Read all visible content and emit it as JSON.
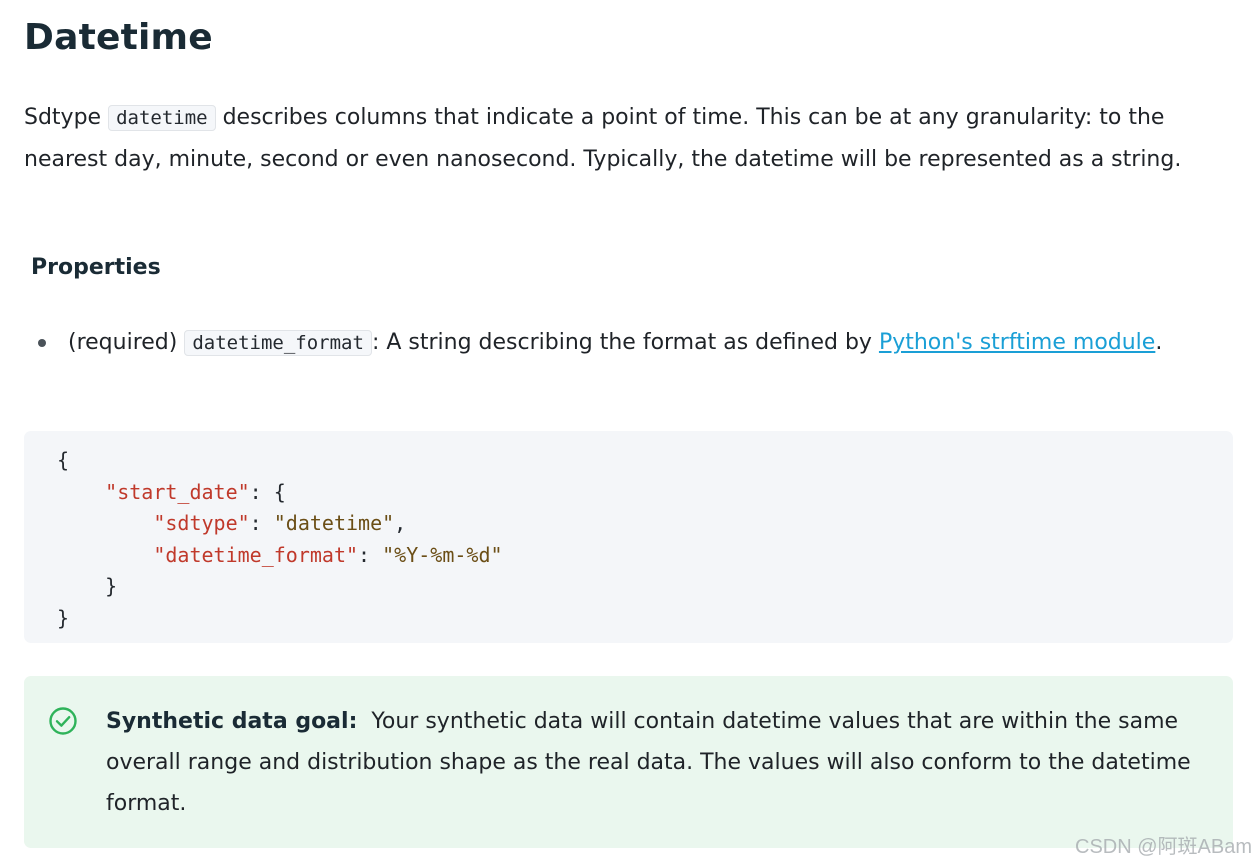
{
  "title": "Datetime",
  "intro": {
    "before": "Sdtype ",
    "code": "datetime",
    "after": " describes columns that indicate a point of time. This can be at any granularity: to the nearest day, minute, second or even nanosecond. Typically, the datetime will be represented as a string."
  },
  "properties": {
    "heading": "Properties",
    "items": [
      {
        "prefix": "(required) ",
        "code": "datetime_format",
        "text": ": A string describing the format as defined by ",
        "link": "Python's strftime module",
        "suffix": "."
      }
    ]
  },
  "code_block": {
    "open_brace": "{",
    "outer_key": "\"start_date\"",
    "sdtype_key": "\"sdtype\"",
    "sdtype_value": "\"datetime\"",
    "format_key": "\"datetime_format\"",
    "format_value": "\"%Y-%m-%d\"",
    "inner_close": "}",
    "close_brace": "}"
  },
  "admonition": {
    "icon": "check-circle-icon",
    "label": "Synthetic data goal:",
    "text": "Your synthetic data will contain datetime values that are within the same overall range and distribution shape as the real data. The values will also conform to the datetime format."
  },
  "colors": {
    "link": "#1a9fd6",
    "json_key": "#c0392b",
    "json_string": "#6b4e16",
    "admonition_bg": "#eaf7ee",
    "admonition_icon": "#2fb35a",
    "code_bg": "#f4f6f9"
  },
  "watermark": "CSDN @阿斑ABam"
}
